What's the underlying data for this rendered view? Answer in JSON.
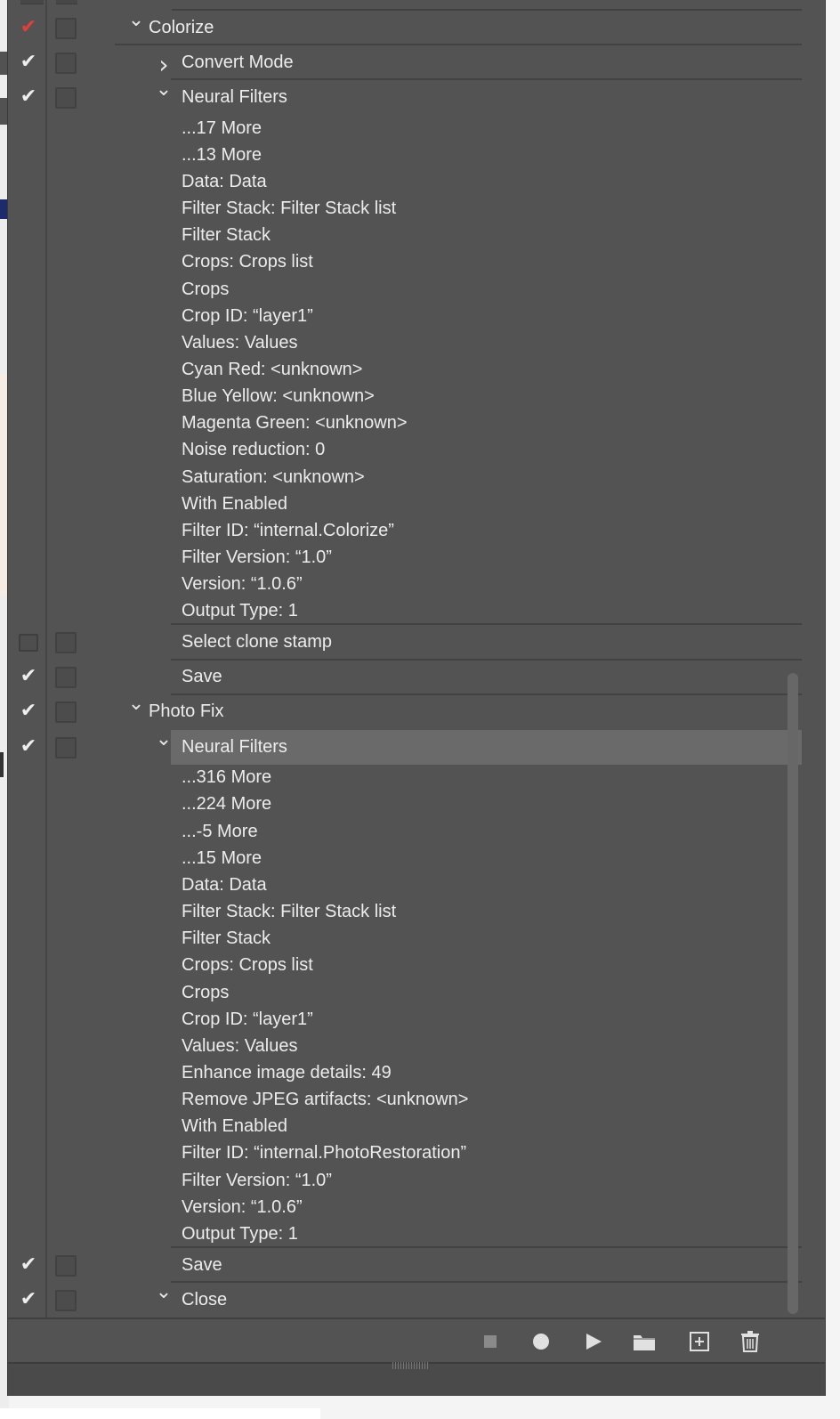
{
  "actions": [
    {
      "type": "item",
      "indent": 1,
      "twisty": "down",
      "label": "Colorize",
      "check": "red",
      "separator": true
    },
    {
      "type": "item",
      "indent": 2,
      "twisty": "right",
      "label": "Convert Mode",
      "check": "check",
      "separator": true
    },
    {
      "type": "item",
      "indent": 2,
      "twisty": "down",
      "label": "Neural Filters",
      "check": "check",
      "separator": false
    },
    {
      "type": "param",
      "text": "...17 More"
    },
    {
      "type": "param",
      "text": "...13 More"
    },
    {
      "type": "param",
      "text": "Data: Data"
    },
    {
      "type": "param",
      "text": "Filter Stack: Filter Stack list"
    },
    {
      "type": "param",
      "text": "Filter Stack"
    },
    {
      "type": "param",
      "text": "Crops: Crops list"
    },
    {
      "type": "param",
      "text": "Crops"
    },
    {
      "type": "param",
      "text": "Crop ID:  “layer1”"
    },
    {
      "type": "param",
      "text": "Values: Values"
    },
    {
      "type": "param",
      "text": "Cyan Red:  <unknown>"
    },
    {
      "type": "param",
      "text": "Blue Yellow:  <unknown>"
    },
    {
      "type": "param",
      "text": "Magenta Green:  <unknown>"
    },
    {
      "type": "param",
      "text": "Noise reduction: 0"
    },
    {
      "type": "param",
      "text": "Saturation:  <unknown>"
    },
    {
      "type": "param",
      "text": "With Enabled"
    },
    {
      "type": "param",
      "text": "Filter ID:  “internal.Colorize”"
    },
    {
      "type": "param",
      "text": "Filter Version:  “1.0”"
    },
    {
      "type": "param",
      "text": "Version:  “1.0.6”"
    },
    {
      "type": "param",
      "text": "Output Type: 1",
      "separator_after": true
    },
    {
      "type": "item",
      "indent": 2,
      "twisty": "none",
      "label": "Select clone stamp",
      "check": "empty",
      "separator": true
    },
    {
      "type": "item",
      "indent": 2,
      "twisty": "none",
      "label": "Save",
      "check": "check",
      "separator": true
    },
    {
      "type": "item",
      "indent": 1,
      "twisty": "down",
      "label": "Photo Fix",
      "check": "check",
      "separator": false
    },
    {
      "type": "item",
      "indent": 2,
      "twisty": "down",
      "label": "Neural Filters",
      "check": "check",
      "separator": false,
      "selected": true
    },
    {
      "type": "param",
      "text": "...316 More"
    },
    {
      "type": "param",
      "text": "...224 More"
    },
    {
      "type": "param",
      "text": "...-5 More"
    },
    {
      "type": "param",
      "text": "...15 More"
    },
    {
      "type": "param",
      "text": "Data: Data"
    },
    {
      "type": "param",
      "text": "Filter Stack: Filter Stack list"
    },
    {
      "type": "param",
      "text": "Filter Stack"
    },
    {
      "type": "param",
      "text": "Crops: Crops list"
    },
    {
      "type": "param",
      "text": "Crops"
    },
    {
      "type": "param",
      "text": "Crop ID:  “layer1”"
    },
    {
      "type": "param",
      "text": "Values: Values"
    },
    {
      "type": "param",
      "text": "Enhance image details: 49"
    },
    {
      "type": "param",
      "text": "Remove JPEG artifacts:  <unknown>"
    },
    {
      "type": "param",
      "text": "With Enabled"
    },
    {
      "type": "param",
      "text": "Filter ID:  “internal.PhotoRestoration”"
    },
    {
      "type": "param",
      "text": "Filter Version:  “1.0”"
    },
    {
      "type": "param",
      "text": "Version:  “1.0.6”"
    },
    {
      "type": "param",
      "text": "Output Type: 1",
      "separator_after": true
    },
    {
      "type": "item",
      "indent": 2,
      "twisty": "none",
      "label": "Save",
      "check": "check",
      "separator": true
    },
    {
      "type": "item",
      "indent": 2,
      "twisty": "down",
      "label": "Close",
      "check": "check",
      "separator": false
    }
  ],
  "footer_buttons": [
    {
      "name": "stop-button",
      "icon": "stop-icon"
    },
    {
      "name": "record-button",
      "icon": "record-icon"
    },
    {
      "name": "play-button",
      "icon": "play-icon"
    },
    {
      "name": "new-set-button",
      "icon": "folder-icon"
    },
    {
      "name": "new-action-button",
      "icon": "new-item-icon"
    },
    {
      "name": "delete-button",
      "icon": "trash-icon"
    }
  ],
  "colors": {
    "panel": "#535353",
    "selected_row": "#6a6a6a",
    "checkmark": "#eeeeee",
    "checkmark_red": "#e0403a"
  }
}
